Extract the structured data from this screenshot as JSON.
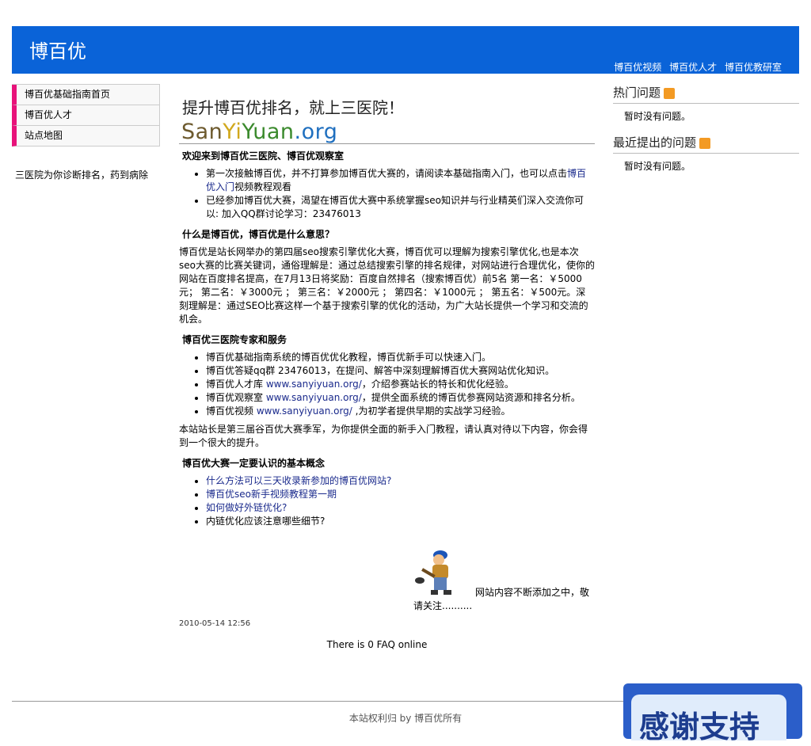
{
  "header": {
    "title": "博百优",
    "links": [
      "博百优视频",
      "博百优人才",
      "博百优教研室"
    ]
  },
  "left": {
    "nav": [
      "博百优基础指南首页",
      "博百优人才",
      "站点地图"
    ],
    "note": "三医院为你诊断排名，药到病除"
  },
  "main": {
    "heading": "提升博百优排名，就上三医院！",
    "logo": {
      "p1": "San",
      "p2": "Yi",
      "p3": "Yuan",
      "p4": ".org"
    },
    "welcome": "欢迎来到博百优三医院、博百优观察室",
    "intro": {
      "item1_text": "第一次接触博百优，并不打算参加博百优大赛的，请阅读本基础指南入门，也可以点击",
      "item1_link": "博百优入门",
      "item1_tail": "视频教程观看",
      "item2": "已经参加博百优大赛，渴望在博百优大赛中系统掌握seo知识并与行业精英们深入交流你可以: 加入QQ群讨论学习：23476013"
    },
    "what_title": "什么是博百优，博百优是什么意思？",
    "what_text": "博百优是站长网举办的第四届seo搜索引擎优化大赛，博百优可以理解为搜索引擎优化,也是本次seo大赛的比赛关键词，通俗理解是：通过总结搜索引擎的排名规律，对网站进行合理优化，使你的网站在百度排名提高，在7月13日将奖励：百度自然排名（搜索博百优）前5名 第一名：￥5000元； 第二名：￥3000元 ； 第三名：￥2000元 ； 第四名：￥1000元 ； 第五名：￥500元。深刻理解是：通过SEO比赛这样一个基于搜索引擎的优化的活动，为广大站长提供一个学习和交流的机会。",
    "service_title": "博百优三医院专家和服务",
    "services": [
      {
        "pre": "博百优基础指南系统的博百优优化教程，博百优新手可以快速入门。",
        "link": "",
        "post": ""
      },
      {
        "pre": "博百优答疑qq群 23476013，在提问、解答中深刻理解博百优大赛网站优化知识。",
        "link": "",
        "post": ""
      },
      {
        "pre": "博百优人才库 ",
        "link": "www.sanyiyuan.org/",
        "post": "，介绍参赛站长的特长和优化经验。"
      },
      {
        "pre": "博百优观察室 ",
        "link": "www.sanyiyuan.org/",
        "post": "，提供全面系统的博百优参赛网站资源和排名分析。"
      },
      {
        "pre": "博百优视频 ",
        "link": "www.sanyiyuan.org/",
        "post": " ,为初学者提供早期的实战学习经验。"
      }
    ],
    "admin_note": " 本站站长是第三届谷百优大赛季军，为你提供全面的新手入门教程，请认真对待以下内容，你会得到一个很大的提升。",
    "concept_title": "博百优大赛一定要认识的基本概念",
    "concepts": [
      {
        "text": "什么方法可以三天收录新参加的博百优网站?",
        "link": true
      },
      {
        "text": "博百优seo新手视频教程第一期",
        "link": true
      },
      {
        "text": "如何做好外链优化?",
        "link": true
      },
      {
        "text": "内链优化应该注意哪些细节?",
        "link": false
      }
    ],
    "update_text": "网站内容不断添加之中，敬请关注..........",
    "date": "2010-05-14 12:56",
    "faq_online": "There is 0 FAQ online"
  },
  "right": {
    "hot_title": "热门问题",
    "hot_body": "暂时没有问题。",
    "recent_title": "最近提出的问题",
    "recent_body": "暂时没有问题。"
  },
  "footer": {
    "copyright": "本站权利归 by 博百优所有",
    "thanks": "感谢支持"
  },
  "colors": {
    "header_bg": "#0a63d8",
    "nav_accent": "#e8127a",
    "rss": "#f39a23"
  }
}
